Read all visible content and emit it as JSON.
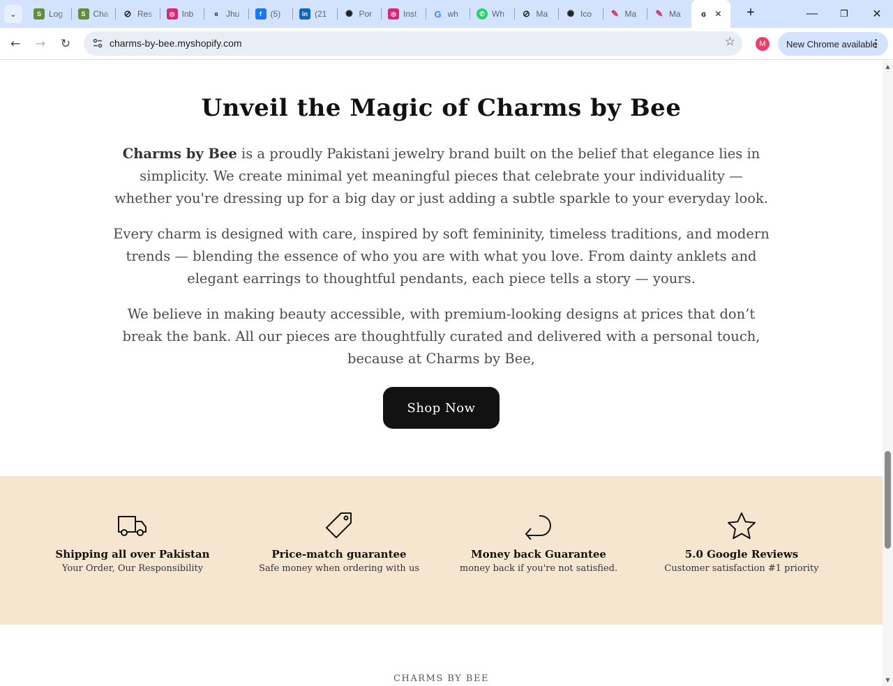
{
  "browser": {
    "tabs": [
      {
        "title": "Log",
        "icon": "shopify-icon",
        "color": "#5e8e3e",
        "glyph": "S"
      },
      {
        "title": "Cha",
        "icon": "shopify-icon",
        "color": "#5e8e3e",
        "glyph": "S"
      },
      {
        "title": "Res",
        "icon": "slashed-circle-icon",
        "color": "#202124",
        "glyph": "⊘"
      },
      {
        "title": "Inb",
        "icon": "instagram-icon",
        "color": "#d62976",
        "glyph": "◎"
      },
      {
        "title": "Jhu",
        "icon": "site-logo-icon",
        "color": "#ffffff",
        "glyph": "ɞ"
      },
      {
        "title": "(5)",
        "icon": "facebook-icon",
        "color": "#1877f2",
        "glyph": "f"
      },
      {
        "title": "(21",
        "icon": "linkedin-icon",
        "color": "#0a66c2",
        "glyph": "in"
      },
      {
        "title": "Por",
        "icon": "openai-icon",
        "color": "#202124",
        "glyph": "✺"
      },
      {
        "title": "Inst",
        "icon": "instagram-icon",
        "color": "#d62976",
        "glyph": "◎"
      },
      {
        "title": "wh",
        "icon": "google-icon",
        "color": "#4285f4",
        "glyph": "G"
      },
      {
        "title": "Wh",
        "icon": "whatsapp-icon",
        "color": "#25d366",
        "glyph": "✆"
      },
      {
        "title": "Ma",
        "icon": "slashed-circle-icon",
        "color": "#202124",
        "glyph": "⊘"
      },
      {
        "title": "Ico",
        "icon": "openai-icon",
        "color": "#202124",
        "glyph": "✺"
      },
      {
        "title": "Ma",
        "icon": "pen-icon",
        "color": "#e0245e",
        "glyph": "✎"
      },
      {
        "title": "Ma",
        "icon": "pen-icon",
        "color": "#e0245e",
        "glyph": "✎"
      }
    ],
    "active_tab_icon_glyph": "ɞ",
    "url": "charms-by-bee.myshopify.com",
    "profile_initial": "M",
    "update_label": "New Chrome available"
  },
  "page": {
    "heading": "Unveil the Magic of Charms by Bee",
    "intro_bold": "Charms by Bee",
    "intro_rest": " is a proudly Pakistani jewelry brand built on the belief that elegance lies in simplicity. We create minimal yet meaningful pieces that celebrate your individuality — whether you're dressing up for a big day or just adding a subtle sparkle to your everyday look.",
    "paragraph2": "Every charm is designed with care, inspired by soft femininity, timeless traditions, and modern trends — blending the essence of who you are with what you love. From dainty anklets and elegant earrings to thoughtful pendants, each piece tells a story — yours.",
    "paragraph3": "We believe in making beauty accessible, with premium-looking designs at prices that don’t break the bank. All our pieces are thoughtfully curated and delivered with a personal touch, because at Charms by Bee,",
    "shop_button": "Shop Now",
    "features": [
      {
        "icon": "truck-icon",
        "title": "Shipping all over Pakistan",
        "desc": "Your Order, Our Responsibility"
      },
      {
        "icon": "price-tag-icon",
        "title": "Price-match guarantee",
        "desc": "Safe money when ordering with us"
      },
      {
        "icon": "return-arrow-icon",
        "title": "Money back Guarantee",
        "desc": "money back if you're not satisfied."
      },
      {
        "icon": "star-icon",
        "title": "5.0 Google Reviews",
        "desc": "Customer satisfaction #1 priority"
      }
    ],
    "footer_brand": "CHARMS BY BEE"
  },
  "colors": {
    "feature_band": "#f6e6d0",
    "button": "#121212",
    "tabstrip": "#d3e3fd"
  }
}
